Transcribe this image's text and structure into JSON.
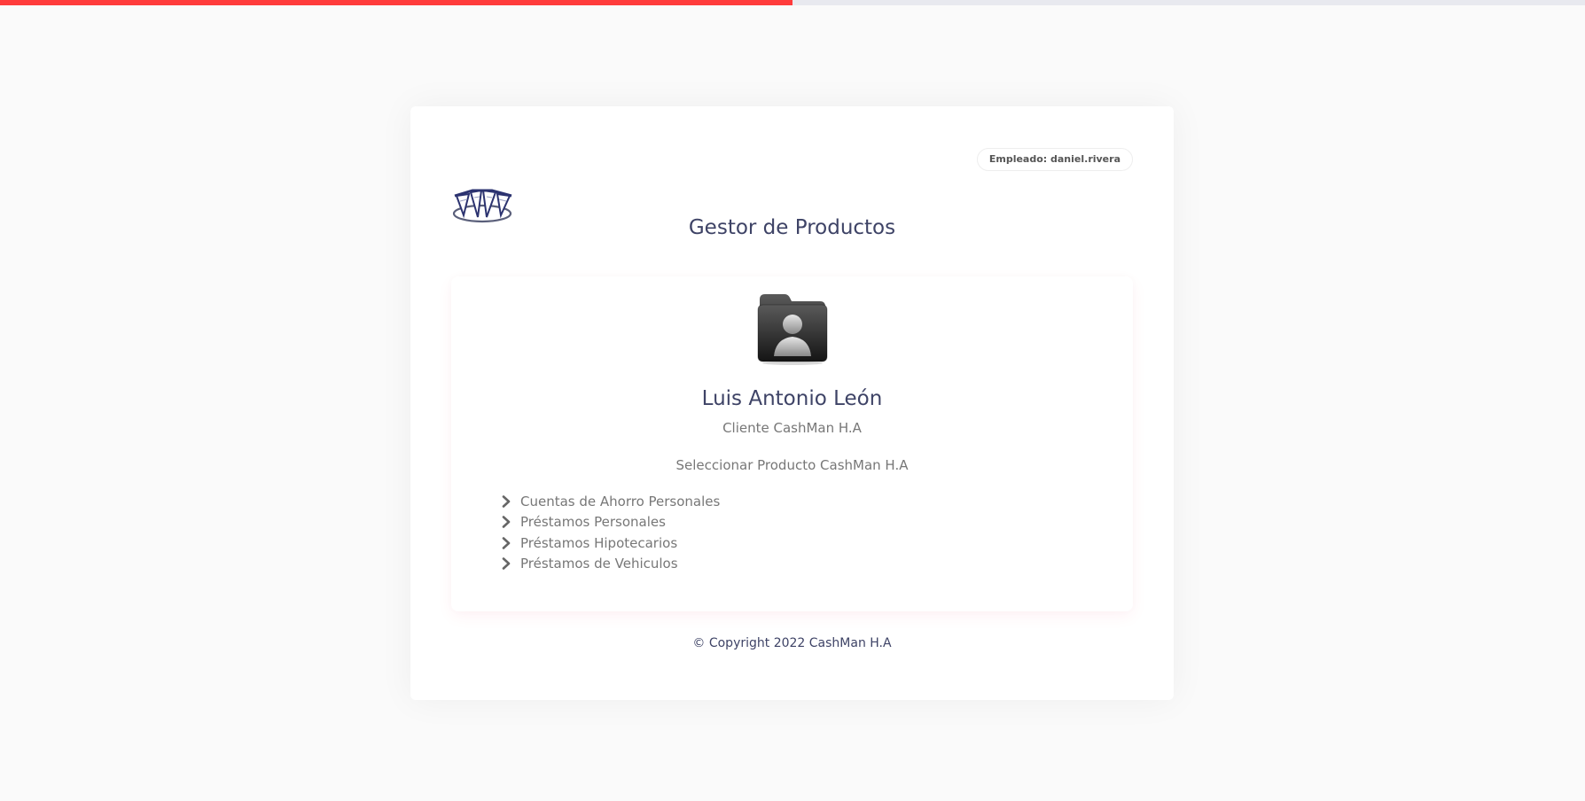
{
  "progress": {
    "value": 0.5,
    "color": "#ff3b3b"
  },
  "header": {
    "employee_badge": "Empleado: daniel.rivera",
    "title": "Gestor de Productos"
  },
  "client": {
    "name": "Luis Antonio León",
    "subtitle": "Cliente CashMan H.A",
    "avatar_icon": "user-folder-icon"
  },
  "products": {
    "heading": "Seleccionar Producto CashMan H.A",
    "items": [
      {
        "label": "Cuentas de Ahorro Personales",
        "icon": "chevron-right-icon"
      },
      {
        "label": "Préstamos Personales",
        "icon": "chevron-right-icon"
      },
      {
        "label": "Préstamos Hipotecarios",
        "icon": "chevron-right-icon"
      },
      {
        "label": "Préstamos de Vehiculos",
        "icon": "chevron-right-icon"
      }
    ]
  },
  "footer": {
    "copyright": "© Copyright 2022 CashMan H.A"
  },
  "colors": {
    "title": "#3e4366",
    "muted_text": "#777777",
    "accent": "#ff3b3b"
  }
}
